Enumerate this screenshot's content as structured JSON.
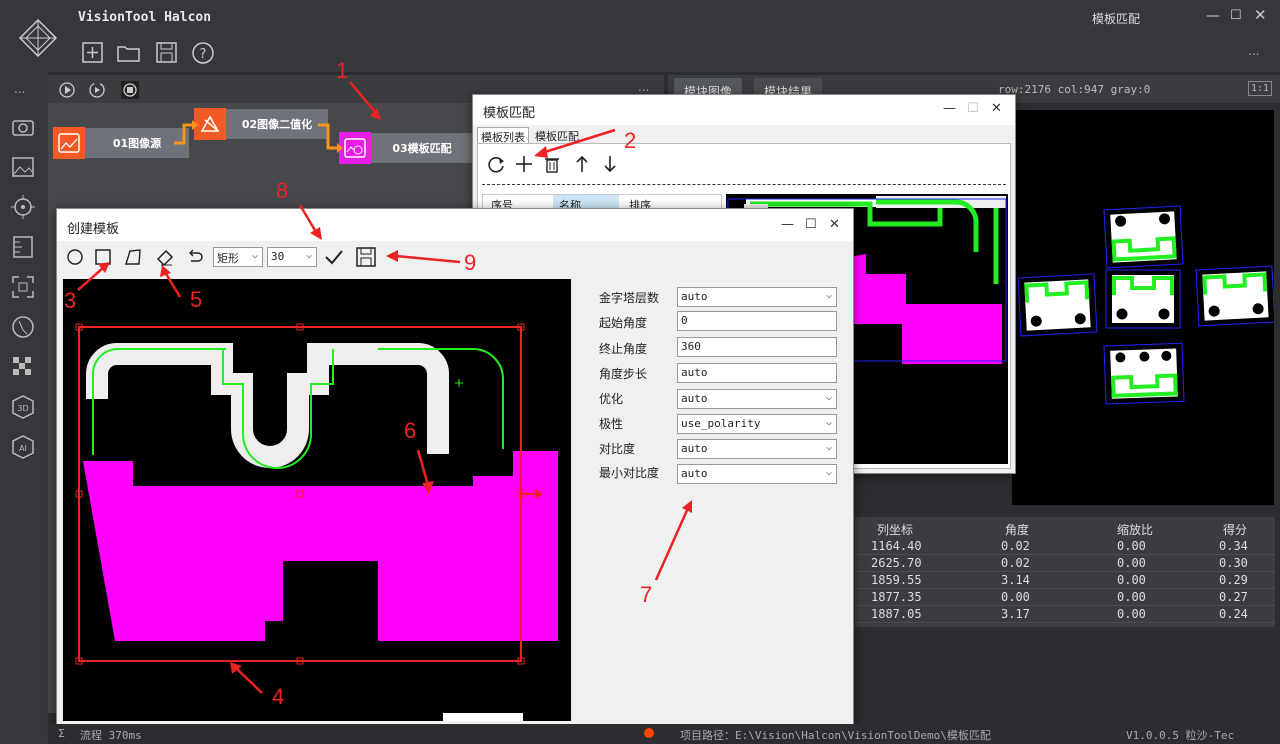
{
  "app": {
    "title": "VisionTool Halcon",
    "window_title": "模板匹配"
  },
  "flow": {
    "nodes": [
      {
        "label": "01图像源",
        "color": "#f15a24"
      },
      {
        "label": "02图像二值化",
        "color": "#f15a24"
      },
      {
        "label": "03模板匹配",
        "color": "#e91ee6"
      }
    ]
  },
  "image_tabs": {
    "tab1": "模块图像",
    "tab2": "模块结果",
    "readout": "row:2176 col:947 gray:0",
    "scale": "1:1"
  },
  "template_dialog": {
    "title": "模板匹配",
    "tabs": [
      "模板列表",
      "模板匹配"
    ],
    "table_headers": [
      "序号",
      "名称",
      "排序"
    ]
  },
  "results": {
    "headers": [
      "列坐标",
      "角度",
      "缩放比",
      "得分"
    ],
    "rows": [
      [
        "1164.40",
        "0.02",
        "0.00",
        "0.34"
      ],
      [
        "2625.70",
        "0.02",
        "0.00",
        "0.30"
      ],
      [
        "1859.55",
        "3.14",
        "0.00",
        "0.29"
      ],
      [
        "1877.35",
        "0.00",
        "0.00",
        "0.27"
      ],
      [
        "1887.05",
        "3.17",
        "0.00",
        "0.24"
      ]
    ]
  },
  "create_dialog": {
    "title": "创建模板",
    "shape_select": "矩形",
    "size_select": "30",
    "params": [
      {
        "label": "金字塔层数",
        "value": "auto",
        "dropdown": true
      },
      {
        "label": "起始角度",
        "value": "0",
        "dropdown": false
      },
      {
        "label": "终止角度",
        "value": "360",
        "dropdown": false
      },
      {
        "label": "角度步长",
        "value": "auto",
        "dropdown": false
      },
      {
        "label": "优化",
        "value": "auto",
        "dropdown": true
      },
      {
        "label": "极性",
        "value": "use_polarity",
        "dropdown": true
      },
      {
        "label": "对比度",
        "value": "auto",
        "dropdown": true
      },
      {
        "label": "最小对比度",
        "value": "auto",
        "dropdown": true
      }
    ]
  },
  "status": {
    "left": "流程 370ms",
    "path": "项目路径：E:\\Vision\\Halcon\\VisionToolDemo\\模板匹配",
    "version": "V1.0.0.5 粒沙-Tec"
  },
  "annotations": [
    "1",
    "2",
    "3",
    "4",
    "5",
    "6",
    "7",
    "8",
    "9"
  ],
  "sidebar": {
    "more": "..."
  },
  "colors": {
    "accent_orange": "#f15a24",
    "magenta": "#ff00ff",
    "green": "#22ee22",
    "annotation": "#ee2222"
  }
}
